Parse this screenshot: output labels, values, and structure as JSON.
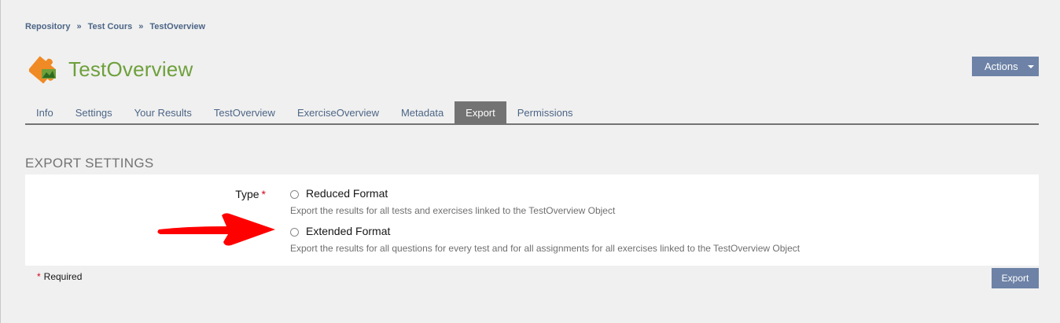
{
  "breadcrumb": {
    "items": [
      "Repository",
      "Test Cours",
      "TestOverview"
    ],
    "separator": "»"
  },
  "header": {
    "title": "TestOverview",
    "title_color": "#6ea03c",
    "icon": "puzzle-piece-icon",
    "actions_label": "Actions"
  },
  "tabs": [
    {
      "label": "Info"
    },
    {
      "label": "Settings"
    },
    {
      "label": "Your Results"
    },
    {
      "label": "TestOverview"
    },
    {
      "label": "ExerciseOverview"
    },
    {
      "label": "Metadata"
    },
    {
      "label": "Export",
      "active": true
    },
    {
      "label": "Permissions"
    }
  ],
  "export": {
    "section_title": "EXPORT SETTINGS",
    "field_label": "Type",
    "required_marker": "*",
    "options": [
      {
        "label": "Reduced Format",
        "description": "Export the results for all tests and exercises linked to the TestOverview Object",
        "selected": false
      },
      {
        "label": "Extended Format",
        "description": "Export the results for all questions for every test and for all assignments for all exercises linked to the TestOverview Object",
        "selected": false
      }
    ],
    "required_note": "Required",
    "submit_label": "Export"
  },
  "annotation": {
    "icon": "red-arrow-icon",
    "color": "#ff0000"
  },
  "colors": {
    "accent": "#6d82a6",
    "link": "#4c6586",
    "active_tab": "#737373",
    "required": "#d6031a"
  }
}
